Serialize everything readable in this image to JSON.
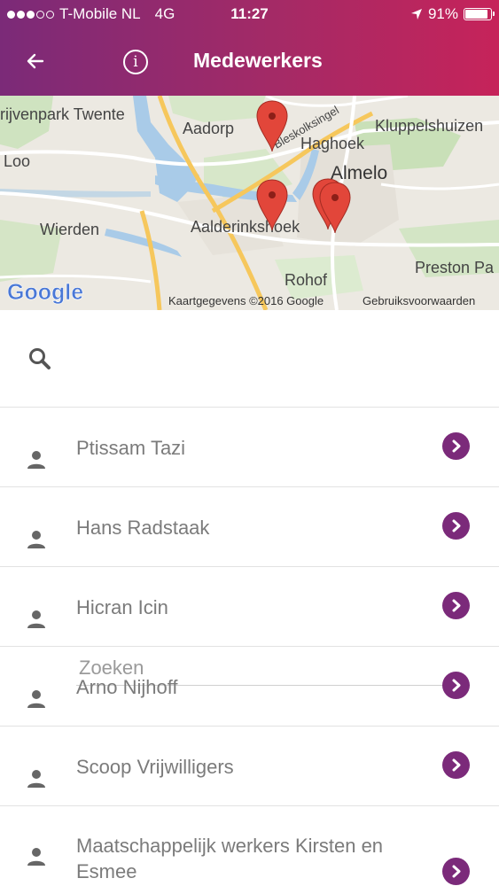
{
  "status_bar": {
    "carrier": "T-Mobile NL",
    "network": "4G",
    "time": "11:27",
    "battery": "91%",
    "battery_level": 0.91
  },
  "header": {
    "title": "Medewerkers",
    "back_icon": "arrow-left-icon",
    "info_icon": "info-icon"
  },
  "map": {
    "labels": [
      "rijvenpark Twente",
      "Aadorp",
      "Kluppelshuizen",
      "Haghoek",
      "Loo",
      "Almelo",
      "Wierden",
      "Aalderinkshoek",
      "Preston Pa",
      "Rohof",
      "Bleskolksingel"
    ],
    "attribution": "Kaartgegevens ©2016 Google",
    "terms": "Gebruiksvoorwaarden",
    "logo": "Google"
  },
  "search": {
    "placeholder": "Zoeken",
    "value": ""
  },
  "colleagues": [
    {
      "name": "Ptissam Tazi"
    },
    {
      "name": "Hans Radstaak"
    },
    {
      "name": "Hicran Icin"
    },
    {
      "name": "Arno Nijhoff"
    },
    {
      "name": "Scoop Vrijwilligers"
    },
    {
      "name": "Maatschappelijk werkers Kirsten en Esmee"
    }
  ],
  "colors": {
    "header_start": "#7b2a78",
    "header_end": "#c6235a",
    "accent": "#7b2a7a",
    "name_text": "#7b7b7b"
  }
}
